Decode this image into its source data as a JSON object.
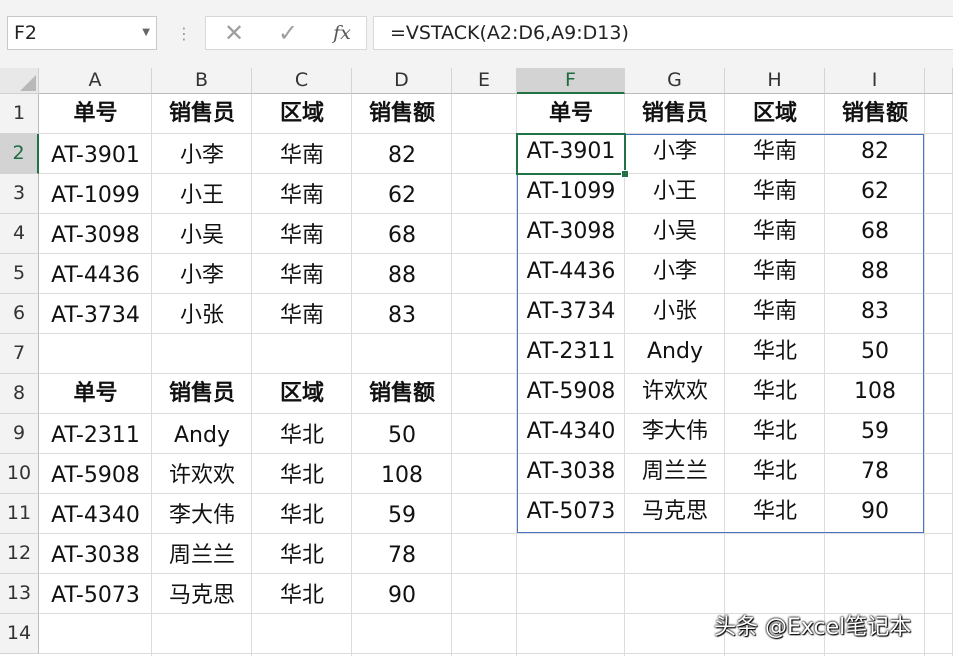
{
  "formula_bar": {
    "name_box": "F2",
    "cancel_icon": "✕",
    "enter_icon": "✓",
    "fx_label": "fx",
    "formula": "=VSTACK(A2:D6,A9:D13)"
  },
  "columns": [
    "A",
    "B",
    "C",
    "D",
    "E",
    "F",
    "G",
    "H",
    "I"
  ],
  "rows": [
    "1",
    "2",
    "3",
    "4",
    "5",
    "6",
    "7",
    "8",
    "9",
    "10",
    "11",
    "12",
    "13",
    "14"
  ],
  "selected": {
    "column": "F",
    "row": "2"
  },
  "table1": {
    "headers": [
      "单号",
      "销售员",
      "区域",
      "销售额"
    ],
    "rows": [
      [
        "AT-3901",
        "小李",
        "华南",
        "82"
      ],
      [
        "AT-1099",
        "小王",
        "华南",
        "62"
      ],
      [
        "AT-3098",
        "小吴",
        "华南",
        "68"
      ],
      [
        "AT-4436",
        "小李",
        "华南",
        "88"
      ],
      [
        "AT-3734",
        "小张",
        "华南",
        "83"
      ]
    ]
  },
  "table2": {
    "headers": [
      "单号",
      "销售员",
      "区域",
      "销售额"
    ],
    "rows": [
      [
        "AT-2311",
        "Andy",
        "华北",
        "50"
      ],
      [
        "AT-5908",
        "许欢欢",
        "华北",
        "108"
      ],
      [
        "AT-4340",
        "李大伟",
        "华北",
        "59"
      ],
      [
        "AT-3038",
        "周兰兰",
        "华北",
        "78"
      ],
      [
        "AT-5073",
        "马克思",
        "华北",
        "90"
      ]
    ]
  },
  "result": {
    "headers": [
      "单号",
      "销售员",
      "区域",
      "销售额"
    ],
    "rows": [
      [
        "AT-3901",
        "小李",
        "华南",
        "82"
      ],
      [
        "AT-1099",
        "小王",
        "华南",
        "62"
      ],
      [
        "AT-3098",
        "小吴",
        "华南",
        "68"
      ],
      [
        "AT-4436",
        "小李",
        "华南",
        "88"
      ],
      [
        "AT-3734",
        "小张",
        "华南",
        "83"
      ],
      [
        "AT-2311",
        "Andy",
        "华北",
        "50"
      ],
      [
        "AT-5908",
        "许欢欢",
        "华北",
        "108"
      ],
      [
        "AT-4340",
        "李大伟",
        "华北",
        "59"
      ],
      [
        "AT-3038",
        "周兰兰",
        "华北",
        "78"
      ],
      [
        "AT-5073",
        "马克思",
        "华北",
        "90"
      ]
    ]
  },
  "watermark": "头条 @Excel笔记本",
  "colors": {
    "accent_green": "#217346",
    "spill_border": "#4a73c4"
  }
}
